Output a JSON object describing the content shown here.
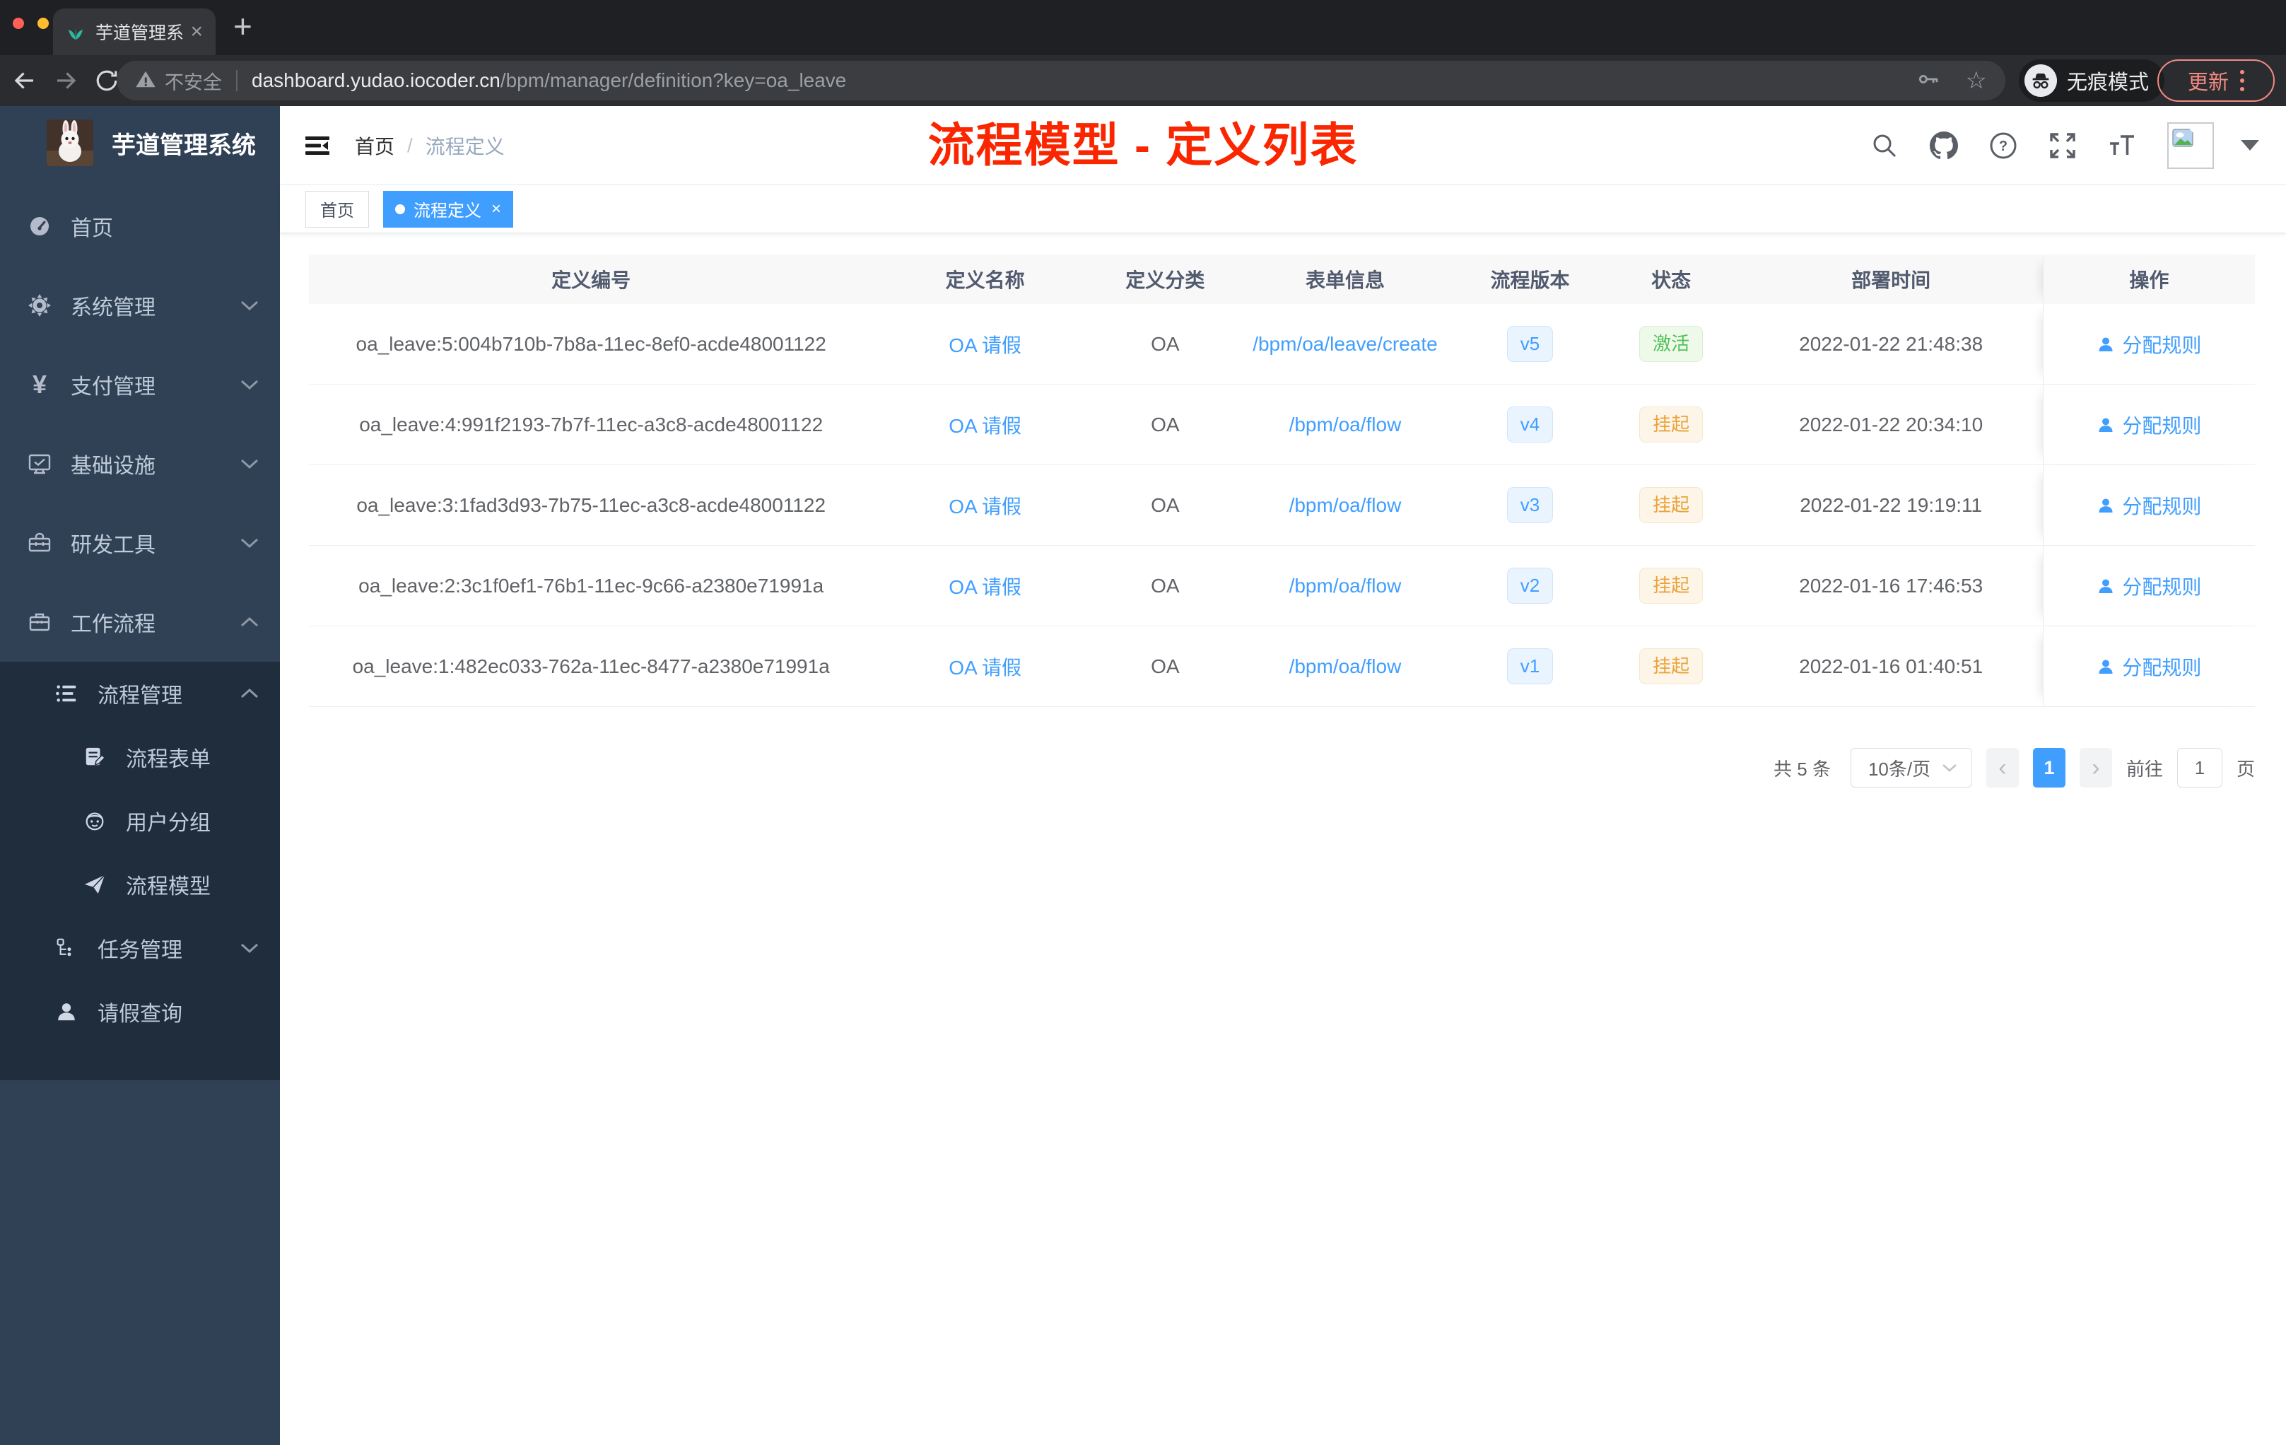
{
  "colors": {
    "primary": "#409eff",
    "sidebar_bg": "#304156",
    "sidebar_sub_bg": "#1f2d3d",
    "annotation_red": "#fa2600",
    "status_active_text": "#51c158",
    "status_suspend_text": "#eba239",
    "update_button": "#f28b82"
  },
  "glyphs": {
    "close": "×",
    "plus": "+",
    "star": "☆",
    "prev": "‹",
    "next": "›"
  },
  "browser": {
    "tab_title": "芋道管理系统",
    "security": "不安全",
    "host": "dashboard.yudao.iocoder.cn",
    "path": "/bpm/manager/definition?key=oa_leave",
    "incognito": "无痕模式",
    "update": "更新"
  },
  "sidebar": {
    "title": "芋道管理系统",
    "menu": [
      {
        "label": "首页"
      },
      {
        "label": "系统管理"
      },
      {
        "label": "支付管理"
      },
      {
        "label": "基础设施"
      },
      {
        "label": "研发工具"
      },
      {
        "label": "工作流程"
      }
    ],
    "submenu": {
      "items": [
        {
          "label": "流程管理"
        },
        {
          "label": "流程表单"
        },
        {
          "label": "用户分组"
        },
        {
          "label": "流程模型"
        },
        {
          "label": "任务管理"
        },
        {
          "label": "请假查询"
        }
      ]
    }
  },
  "header": {
    "breadcrumb": [
      "首页",
      "流程定义"
    ],
    "separator": "/"
  },
  "annotation": "流程模型 - 定义列表",
  "tags": [
    {
      "label": "首页"
    },
    {
      "label": "流程定义"
    }
  ],
  "table": {
    "headers": [
      "定义编号",
      "定义名称",
      "定义分类",
      "表单信息",
      "流程版本",
      "状态",
      "部署时间",
      "操作"
    ],
    "action_label": "分配规则",
    "rows": [
      {
        "id": "oa_leave:5:004b710b-7b8a-11ec-8ef0-acde48001122",
        "name": "OA 请假",
        "category": "OA",
        "form": "/bpm/oa/leave/create",
        "version": "v5",
        "status": "激活",
        "time": "2022-01-22 21:48:38"
      },
      {
        "id": "oa_leave:4:991f2193-7b7f-11ec-a3c8-acde48001122",
        "name": "OA 请假",
        "category": "OA",
        "form": "/bpm/oa/flow",
        "version": "v4",
        "status": "挂起",
        "time": "2022-01-22 20:34:10"
      },
      {
        "id": "oa_leave:3:1fad3d93-7b75-11ec-a3c8-acde48001122",
        "name": "OA 请假",
        "category": "OA",
        "form": "/bpm/oa/flow",
        "version": "v3",
        "status": "挂起",
        "time": "2022-01-22 19:19:11"
      },
      {
        "id": "oa_leave:2:3c1f0ef1-76b1-11ec-9c66-a2380e71991a",
        "name": "OA 请假",
        "category": "OA",
        "form": "/bpm/oa/flow",
        "version": "v2",
        "status": "挂起",
        "time": "2022-01-16 17:46:53"
      },
      {
        "id": "oa_leave:1:482ec033-762a-11ec-8477-a2380e71991a",
        "name": "OA 请假",
        "category": "OA",
        "form": "/bpm/oa/flow",
        "version": "v1",
        "status": "挂起",
        "time": "2022-01-16 01:40:51"
      }
    ]
  },
  "pagination": {
    "total": "共 5 条",
    "page_size": "10条/页",
    "current": "1",
    "goto": "前往",
    "goto_value": "1",
    "unit": "页"
  }
}
